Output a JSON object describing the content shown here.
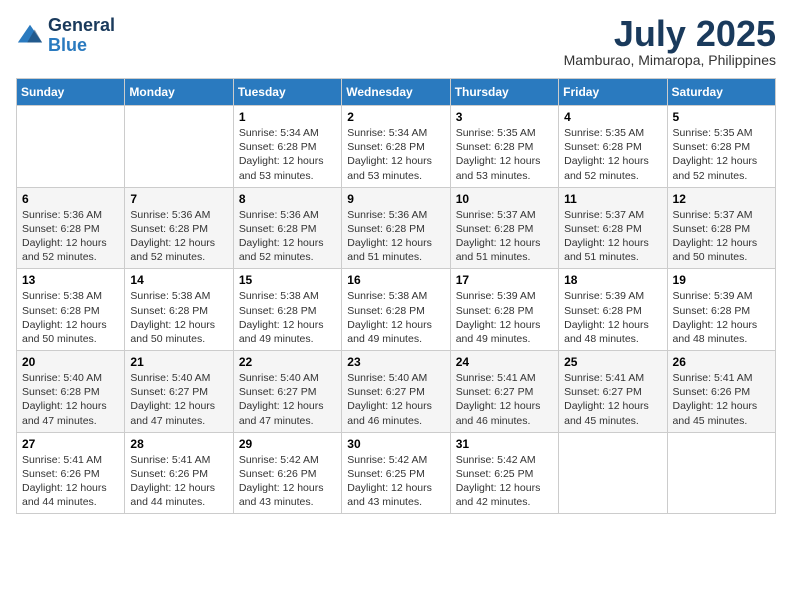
{
  "header": {
    "logo_general": "General",
    "logo_blue": "Blue",
    "title": "July 2025",
    "subtitle": "Mamburao, Mimaropa, Philippines"
  },
  "weekdays": [
    "Sunday",
    "Monday",
    "Tuesday",
    "Wednesday",
    "Thursday",
    "Friday",
    "Saturday"
  ],
  "weeks": [
    [
      {
        "day": "",
        "info": ""
      },
      {
        "day": "",
        "info": ""
      },
      {
        "day": "1",
        "info": "Sunrise: 5:34 AM\nSunset: 6:28 PM\nDaylight: 12 hours and 53 minutes."
      },
      {
        "day": "2",
        "info": "Sunrise: 5:34 AM\nSunset: 6:28 PM\nDaylight: 12 hours and 53 minutes."
      },
      {
        "day": "3",
        "info": "Sunrise: 5:35 AM\nSunset: 6:28 PM\nDaylight: 12 hours and 53 minutes."
      },
      {
        "day": "4",
        "info": "Sunrise: 5:35 AM\nSunset: 6:28 PM\nDaylight: 12 hours and 52 minutes."
      },
      {
        "day": "5",
        "info": "Sunrise: 5:35 AM\nSunset: 6:28 PM\nDaylight: 12 hours and 52 minutes."
      }
    ],
    [
      {
        "day": "6",
        "info": "Sunrise: 5:36 AM\nSunset: 6:28 PM\nDaylight: 12 hours and 52 minutes."
      },
      {
        "day": "7",
        "info": "Sunrise: 5:36 AM\nSunset: 6:28 PM\nDaylight: 12 hours and 52 minutes."
      },
      {
        "day": "8",
        "info": "Sunrise: 5:36 AM\nSunset: 6:28 PM\nDaylight: 12 hours and 52 minutes."
      },
      {
        "day": "9",
        "info": "Sunrise: 5:36 AM\nSunset: 6:28 PM\nDaylight: 12 hours and 51 minutes."
      },
      {
        "day": "10",
        "info": "Sunrise: 5:37 AM\nSunset: 6:28 PM\nDaylight: 12 hours and 51 minutes."
      },
      {
        "day": "11",
        "info": "Sunrise: 5:37 AM\nSunset: 6:28 PM\nDaylight: 12 hours and 51 minutes."
      },
      {
        "day": "12",
        "info": "Sunrise: 5:37 AM\nSunset: 6:28 PM\nDaylight: 12 hours and 50 minutes."
      }
    ],
    [
      {
        "day": "13",
        "info": "Sunrise: 5:38 AM\nSunset: 6:28 PM\nDaylight: 12 hours and 50 minutes."
      },
      {
        "day": "14",
        "info": "Sunrise: 5:38 AM\nSunset: 6:28 PM\nDaylight: 12 hours and 50 minutes."
      },
      {
        "day": "15",
        "info": "Sunrise: 5:38 AM\nSunset: 6:28 PM\nDaylight: 12 hours and 49 minutes."
      },
      {
        "day": "16",
        "info": "Sunrise: 5:38 AM\nSunset: 6:28 PM\nDaylight: 12 hours and 49 minutes."
      },
      {
        "day": "17",
        "info": "Sunrise: 5:39 AM\nSunset: 6:28 PM\nDaylight: 12 hours and 49 minutes."
      },
      {
        "day": "18",
        "info": "Sunrise: 5:39 AM\nSunset: 6:28 PM\nDaylight: 12 hours and 48 minutes."
      },
      {
        "day": "19",
        "info": "Sunrise: 5:39 AM\nSunset: 6:28 PM\nDaylight: 12 hours and 48 minutes."
      }
    ],
    [
      {
        "day": "20",
        "info": "Sunrise: 5:40 AM\nSunset: 6:28 PM\nDaylight: 12 hours and 47 minutes."
      },
      {
        "day": "21",
        "info": "Sunrise: 5:40 AM\nSunset: 6:27 PM\nDaylight: 12 hours and 47 minutes."
      },
      {
        "day": "22",
        "info": "Sunrise: 5:40 AM\nSunset: 6:27 PM\nDaylight: 12 hours and 47 minutes."
      },
      {
        "day": "23",
        "info": "Sunrise: 5:40 AM\nSunset: 6:27 PM\nDaylight: 12 hours and 46 minutes."
      },
      {
        "day": "24",
        "info": "Sunrise: 5:41 AM\nSunset: 6:27 PM\nDaylight: 12 hours and 46 minutes."
      },
      {
        "day": "25",
        "info": "Sunrise: 5:41 AM\nSunset: 6:27 PM\nDaylight: 12 hours and 45 minutes."
      },
      {
        "day": "26",
        "info": "Sunrise: 5:41 AM\nSunset: 6:26 PM\nDaylight: 12 hours and 45 minutes."
      }
    ],
    [
      {
        "day": "27",
        "info": "Sunrise: 5:41 AM\nSunset: 6:26 PM\nDaylight: 12 hours and 44 minutes."
      },
      {
        "day": "28",
        "info": "Sunrise: 5:41 AM\nSunset: 6:26 PM\nDaylight: 12 hours and 44 minutes."
      },
      {
        "day": "29",
        "info": "Sunrise: 5:42 AM\nSunset: 6:26 PM\nDaylight: 12 hours and 43 minutes."
      },
      {
        "day": "30",
        "info": "Sunrise: 5:42 AM\nSunset: 6:25 PM\nDaylight: 12 hours and 43 minutes."
      },
      {
        "day": "31",
        "info": "Sunrise: 5:42 AM\nSunset: 6:25 PM\nDaylight: 12 hours and 42 minutes."
      },
      {
        "day": "",
        "info": ""
      },
      {
        "day": "",
        "info": ""
      }
    ]
  ]
}
